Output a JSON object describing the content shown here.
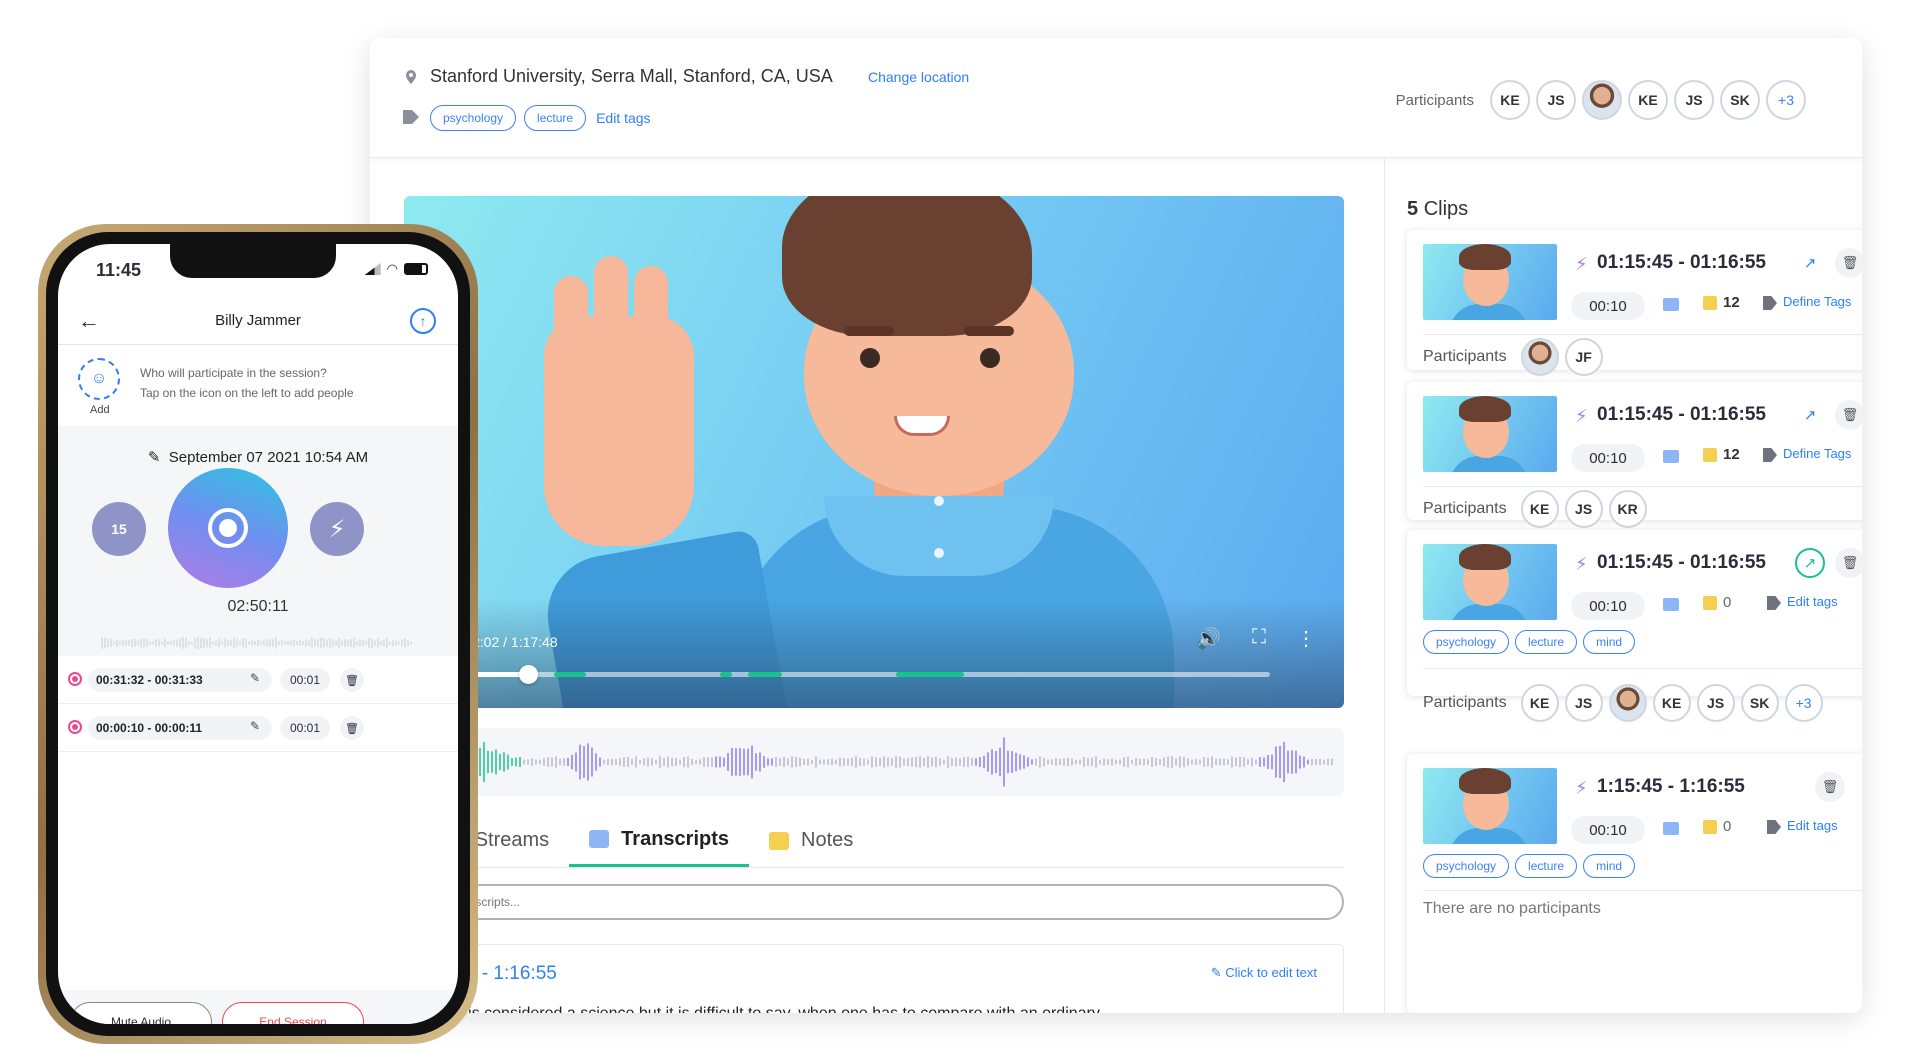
{
  "topbar": {
    "location": "Stanford University, Serra Mall, Stanford, CA, USA",
    "change_location": "Change location",
    "tags": [
      "psychology",
      "lecture"
    ],
    "edit_tags": "Edit tags",
    "participants_label": "Participants",
    "participants": [
      "KE",
      "JS",
      "",
      "KE",
      "JS",
      "SK",
      "+3"
    ]
  },
  "player": {
    "time": "2:02 / 1:17:48",
    "progress": 0.08
  },
  "tabs": [
    "Audio Streams",
    "Transcripts",
    "Notes"
  ],
  "transcript": {
    "search_placeholder": "ch in transcripts...",
    "time": "15:45 - 1:16:55",
    "edit_label": "Click to edit text",
    "text": "ophy is considered a science but it is difficult to say, when one has to compare with an ordinary"
  },
  "clips": {
    "count": "5",
    "title": "Clips",
    "participants_label": "Participants",
    "items": [
      {
        "range": "01:15:45 - 01:16:55",
        "duration": "00:10",
        "notes": "12",
        "tags_label": "Define Tags",
        "participants": [
          "",
          "JF"
        ]
      },
      {
        "range": "01:15:45 - 01:16:55",
        "duration": "00:10",
        "notes": "12",
        "tags_label": "Define Tags",
        "participants": [
          "KE",
          "JS",
          "KR"
        ]
      },
      {
        "range": "01:15:45 - 01:16:55",
        "duration": "00:10",
        "notes": "0",
        "tags_label": "Edit tags",
        "tags": [
          "psychology",
          "lecture",
          "mind"
        ],
        "participants": [
          "KE",
          "JS",
          "",
          "KE",
          "JS",
          "SK",
          "+3"
        ]
      },
      {
        "range": "1:15:45 - 1:16:55",
        "duration": "00:10",
        "notes": "0",
        "tags_label": "Edit tags",
        "tags": [
          "psychology",
          "lecture",
          "mind"
        ],
        "no_participants": "There are no participants"
      }
    ]
  },
  "phone": {
    "clock": "11:45",
    "title": "Billy Jammer",
    "add_label": "Add",
    "who": "Who will participate in the session?",
    "tap": "Tap on the icon on the left to add people",
    "date": "September 07 2021 10:54 AM",
    "rewind": "15",
    "timer": "02:50:11",
    "recordings": [
      {
        "range": "00:31:32 - 00:31:33",
        "duration": "00:01"
      },
      {
        "range": "00:00:10 - 00:00:11",
        "duration": "00:01"
      }
    ],
    "mute": "Mute Audio",
    "end": "End Session"
  },
  "colors": {
    "accent": "#2d7ff9",
    "green": "#18c28a",
    "purple": "#8f94c8"
  }
}
